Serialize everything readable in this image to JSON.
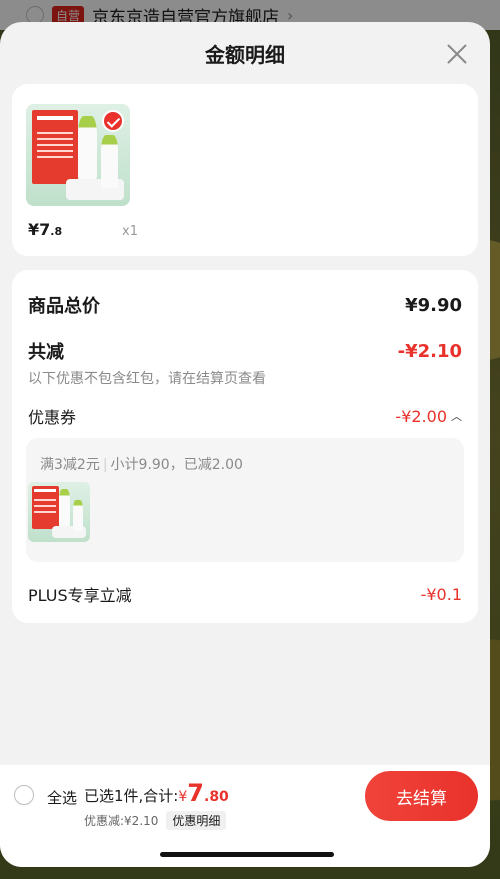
{
  "background": {
    "badge": "自营",
    "shop_name": "京东京造自营官方旗舰店"
  },
  "sheet": {
    "title": "金额明细"
  },
  "product": {
    "price_int": "¥7",
    "price_dec": ".8",
    "quantity": "x1"
  },
  "details": {
    "goods_total_label": "商品总价",
    "goods_total_value": "¥9.90",
    "total_reduce_label": "共减",
    "total_reduce_value": "-¥2.10",
    "hint": "以下优惠不包含红包，请在结算页查看",
    "coupon_label": "优惠券",
    "coupon_value": "-¥2.00",
    "coupon_rule": "满3减2元",
    "coupon_subtotal": "小计9.90，已减2.00",
    "plus_label": "PLUS专享立减",
    "plus_value": "-¥0.1"
  },
  "bottom": {
    "select_all": "全选",
    "selected_summary": "已选1件,合计:",
    "total_yen": "¥",
    "total_int": "7",
    "total_dec": ".80",
    "discount": "优惠减:¥2.10",
    "detail_tag": "优惠明细",
    "checkout": "去结算"
  },
  "colors": {
    "accent": "#e8322b",
    "sheet_bg": "#f2f2f2"
  }
}
